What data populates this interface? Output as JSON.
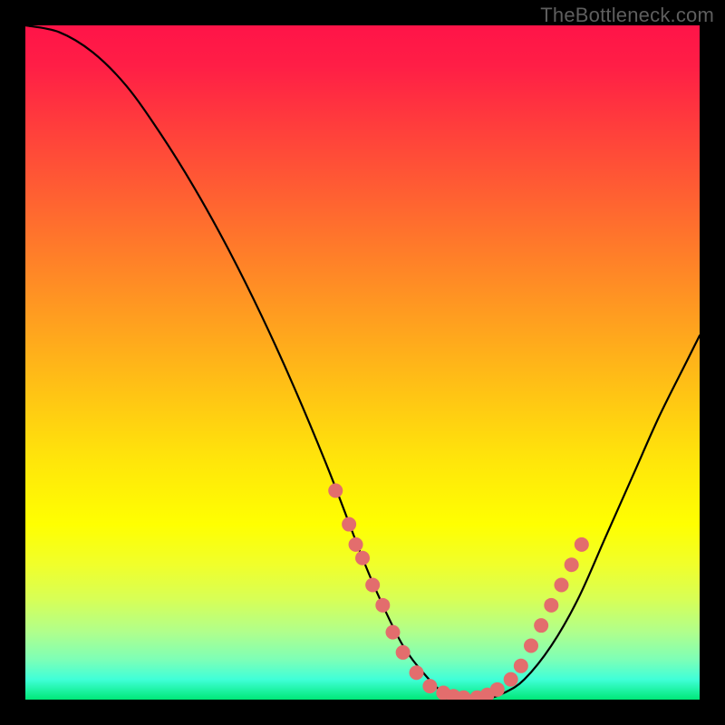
{
  "watermark": "TheBottleneck.com",
  "gradient_colors": {
    "top": "#ff1448",
    "mid_upper": "#ff7e29",
    "mid": "#ffe40b",
    "mid_lower": "#f0ff2b",
    "bottom": "#00e878"
  },
  "chart_data": {
    "type": "line",
    "title": "",
    "xlabel": "",
    "ylabel": "",
    "xlim": [
      0,
      100
    ],
    "ylim": [
      0,
      100
    ],
    "series": [
      {
        "name": "bottleneck-curve",
        "color": "#000000",
        "x": [
          0,
          5,
          10,
          15,
          20,
          25,
          30,
          35,
          40,
          45,
          50,
          53,
          56,
          59,
          62,
          65,
          68,
          71,
          74,
          78,
          82,
          86,
          90,
          94,
          98,
          100
        ],
        "values": [
          100,
          99,
          96,
          91,
          84,
          76,
          67,
          57,
          46,
          34,
          21,
          14,
          8,
          4,
          1,
          0,
          0,
          1,
          3,
          8,
          15,
          24,
          33,
          42,
          50,
          54
        ]
      }
    ],
    "marker_points": {
      "name": "highlighted-dots",
      "color": "#e36d6d",
      "radius": 8,
      "points": [
        {
          "x": 46,
          "y": 31
        },
        {
          "x": 48,
          "y": 26
        },
        {
          "x": 49,
          "y": 23
        },
        {
          "x": 50,
          "y": 21
        },
        {
          "x": 51.5,
          "y": 17
        },
        {
          "x": 53,
          "y": 14
        },
        {
          "x": 54.5,
          "y": 10
        },
        {
          "x": 56,
          "y": 7
        },
        {
          "x": 58,
          "y": 4
        },
        {
          "x": 60,
          "y": 2
        },
        {
          "x": 62,
          "y": 1
        },
        {
          "x": 63.5,
          "y": 0.5
        },
        {
          "x": 65,
          "y": 0.3
        },
        {
          "x": 67,
          "y": 0.3
        },
        {
          "x": 68.5,
          "y": 0.7
        },
        {
          "x": 70,
          "y": 1.5
        },
        {
          "x": 72,
          "y": 3
        },
        {
          "x": 73.5,
          "y": 5
        },
        {
          "x": 75,
          "y": 8
        },
        {
          "x": 76.5,
          "y": 11
        },
        {
          "x": 78,
          "y": 14
        },
        {
          "x": 79.5,
          "y": 17
        },
        {
          "x": 81,
          "y": 20
        },
        {
          "x": 82.5,
          "y": 23
        }
      ]
    }
  }
}
